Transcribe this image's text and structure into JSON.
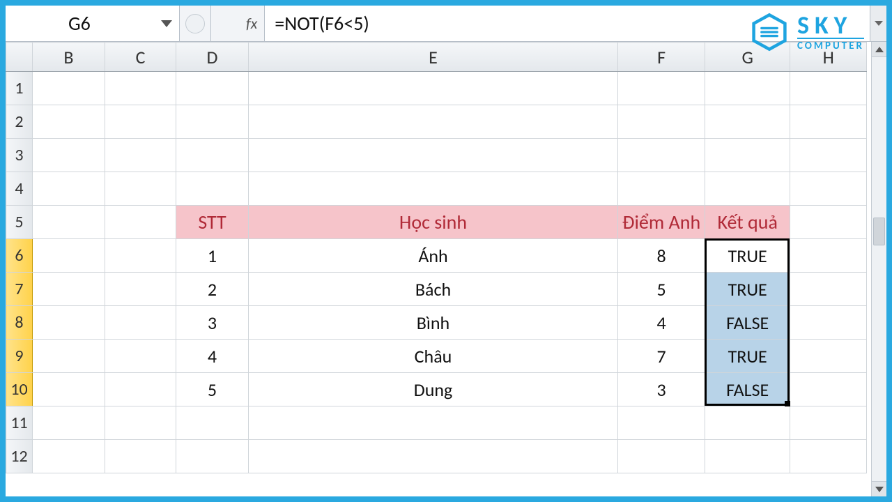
{
  "namebox": {
    "value": "G6"
  },
  "formula": {
    "value": "=NOT(F6<5)",
    "fx_label": "fx"
  },
  "columns": [
    "B",
    "C",
    "D",
    "E",
    "F",
    "G",
    "H"
  ],
  "rows": [
    "1",
    "2",
    "3",
    "4",
    "5",
    "6",
    "7",
    "8",
    "9",
    "10",
    "11",
    "12"
  ],
  "headers": {
    "stt": "STT",
    "hocsinh": "Học sinh",
    "diem": "Điểm Anh",
    "ketqua": "Kết quả"
  },
  "table_rows": [
    {
      "stt": "1",
      "name": "Ánh",
      "score": "8",
      "result": "TRUE"
    },
    {
      "stt": "2",
      "name": "Bách",
      "score": "5",
      "result": "TRUE"
    },
    {
      "stt": "3",
      "name": "Bình",
      "score": "4",
      "result": "FALSE"
    },
    {
      "stt": "4",
      "name": "Châu",
      "score": "7",
      "result": "TRUE"
    },
    {
      "stt": "5",
      "name": "Dung",
      "score": "3",
      "result": "FALSE"
    }
  ],
  "logo": {
    "line1": "SKY",
    "line2": "COMPUTER"
  },
  "colors": {
    "frame": "#2aa9e0",
    "header_pink": "#f6c4ca",
    "header_text": "#b02a37",
    "sel_fill": "#b8d3e8",
    "col_sel": "#ffd24a"
  }
}
